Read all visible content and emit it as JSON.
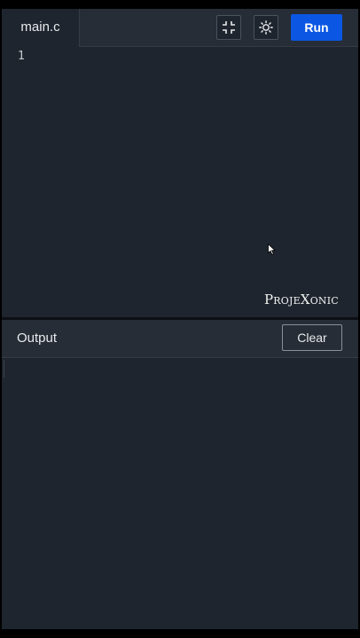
{
  "editor": {
    "file_tab": "main.c",
    "line_numbers": [
      "1"
    ],
    "run_label": "Run",
    "icons": {
      "exit_fullscreen": "exit-fullscreen-icon",
      "theme_toggle": "sun-icon"
    },
    "watermark": "ProjeXonic"
  },
  "output": {
    "title": "Output",
    "clear_label": "Clear",
    "content": ""
  },
  "colors": {
    "background": "#1e252e",
    "header": "#262d36",
    "run_button": "#0b57e3",
    "text": "#e8eaed"
  }
}
